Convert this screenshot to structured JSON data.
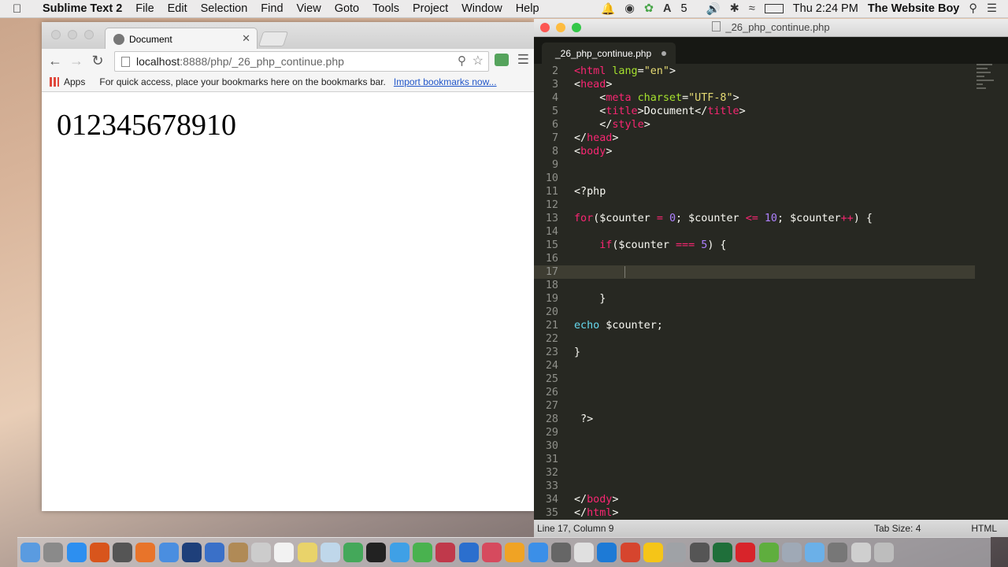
{
  "menubar": {
    "app_name": "Sublime Text 2",
    "items": [
      "File",
      "Edit",
      "Selection",
      "Find",
      "View",
      "Goto",
      "Tools",
      "Project",
      "Window",
      "Help"
    ],
    "adobe_badge": "5",
    "clock": "Thu 2:24 PM",
    "user": "The Website Boy"
  },
  "browser": {
    "tab_title": "Document",
    "url_host": "localhost",
    "url_rest": ":8888/php/_26_php_continue.php",
    "bookmarks": {
      "apps_label": "Apps",
      "hint": "For quick access, place your bookmarks here on the bookmarks bar.",
      "import_link": "Import bookmarks now..."
    },
    "page_output": "012345678910"
  },
  "editor": {
    "window_title": "_26_php_continue.php",
    "tab_label": "_26_php_continue.php",
    "lines": [
      {
        "n": "2",
        "html": "<span class=\"tag\">&lt;html</span> <span class=\"attr\">lang</span>=<span class=\"str\">\"en\"</span>&gt;"
      },
      {
        "n": "3",
        "html": "&lt;<span class=\"tag\">head</span>&gt;"
      },
      {
        "n": "4",
        "html": "    &lt;<span class=\"tag\">meta</span> <span class=\"attr\">charset</span>=<span class=\"str\">\"UTF-8\"</span>&gt;"
      },
      {
        "n": "5",
        "html": "    &lt;<span class=\"tag\">title</span>&gt;Document&lt;/<span class=\"tag\">title</span>&gt;"
      },
      {
        "n": "6",
        "html": "    &lt;/<span class=\"tag\">style</span>&gt;"
      },
      {
        "n": "7",
        "html": "&lt;/<span class=\"tag\">head</span>&gt;"
      },
      {
        "n": "8",
        "html": "&lt;<span class=\"tag\">body</span>&gt;"
      },
      {
        "n": "9",
        "html": ""
      },
      {
        "n": "10",
        "html": ""
      },
      {
        "n": "11",
        "html": "&lt;?php"
      },
      {
        "n": "12",
        "html": ""
      },
      {
        "n": "13",
        "html": "<span class=\"kw\">for</span>($counter <span class=\"kw\">=</span> <span class=\"num\">0</span>; $counter <span class=\"kw\">&lt;=</span> <span class=\"num\">10</span>; $counter<span class=\"kw\">++</span>) {"
      },
      {
        "n": "14",
        "html": ""
      },
      {
        "n": "15",
        "html": "    <span class=\"kw\">if</span>($counter <span class=\"kw\">===</span> <span class=\"num\">5</span>) {"
      },
      {
        "n": "16",
        "html": ""
      },
      {
        "n": "17",
        "html": ""
      },
      {
        "n": "18",
        "html": ""
      },
      {
        "n": "19",
        "html": "    }"
      },
      {
        "n": "20",
        "html": ""
      },
      {
        "n": "21",
        "html": "<span class=\"fn\">echo</span> $counter;"
      },
      {
        "n": "22",
        "html": ""
      },
      {
        "n": "23",
        "html": "}"
      },
      {
        "n": "24",
        "html": ""
      },
      {
        "n": "25",
        "html": ""
      },
      {
        "n": "26",
        "html": ""
      },
      {
        "n": "27",
        "html": ""
      },
      {
        "n": "28",
        "html": " ?&gt;"
      },
      {
        "n": "29",
        "html": ""
      },
      {
        "n": "30",
        "html": ""
      },
      {
        "n": "31",
        "html": ""
      },
      {
        "n": "32",
        "html": ""
      },
      {
        "n": "33",
        "html": ""
      },
      {
        "n": "34",
        "html": "&lt;/<span class=\"tag\">body</span>&gt;"
      },
      {
        "n": "35",
        "html": "&lt;/<span class=\"tag\">html</span>&gt;"
      }
    ],
    "current_line": "17",
    "status": {
      "position": "Line 17, Column 9",
      "tab_size": "Tab Size: 4",
      "syntax": "HTML"
    }
  },
  "dock": {
    "colors": [
      "#5a9be0",
      "#8a8a8a",
      "#2d8ff0",
      "#d8551c",
      "#555555",
      "#e8742a",
      "#4a8ee0",
      "#1e3f7a",
      "#3a70c8",
      "#b08a56",
      "#cccccc",
      "#f2f2f2",
      "#e9d36a",
      "#bfd7ea",
      "#44a85a",
      "#222222",
      "#3fa0e6",
      "#49b24f",
      "#c0394b",
      "#2b6fce",
      "#d64a5e",
      "#f0a324",
      "#3b8fe8",
      "#666666",
      "#e0e0e0",
      "#1d7ad6",
      "#d6452e",
      "#f5c518",
      "#9fa2a6",
      "#555555",
      "#1f6f3a",
      "#d8242a",
      "#5fae3e",
      "#9fa9b6",
      "#6bb0e8",
      "#777777",
      "#cfcfcf",
      "#bdbdbd"
    ]
  }
}
